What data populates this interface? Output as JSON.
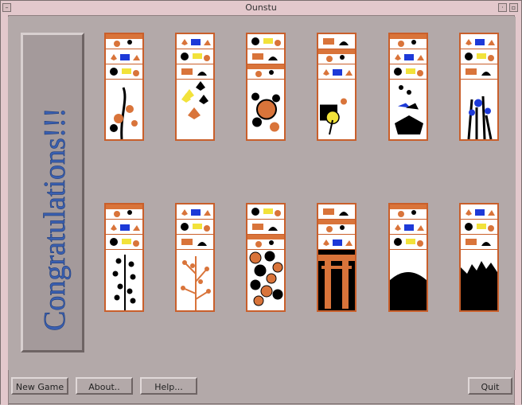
{
  "window": {
    "title": "Ounstu"
  },
  "congrats": {
    "text": "Congratulations!!!"
  },
  "buttons": {
    "new_game": "New Game",
    "about": "About..",
    "help": "Help...",
    "quit": "Quit"
  },
  "colors": {
    "card_border": "#c95f2b",
    "card_orange": "#d9743a",
    "card_black": "#000000",
    "card_blue": "#1d3ad8",
    "card_yellow": "#f2e23a",
    "congrats_text": "#3a5fb0",
    "background": "#b3a9a9"
  },
  "piles": {
    "top": [
      {
        "suit": "plum",
        "icon": "plum-flower-icon"
      },
      {
        "suit": "maple",
        "icon": "maple-leaf-icon"
      },
      {
        "suit": "peony",
        "icon": "peony-flower-icon"
      },
      {
        "suit": "chrysanthemum",
        "icon": "chrysanthemum-icon"
      },
      {
        "suit": "paulownia",
        "icon": "paulownia-icon"
      },
      {
        "suit": "iris",
        "icon": "iris-flower-icon"
      }
    ],
    "bottom": [
      {
        "suit": "bush-clover",
        "icon": "bush-clover-icon"
      },
      {
        "suit": "willow",
        "icon": "willow-icon"
      },
      {
        "suit": "cherry",
        "icon": "cherry-blossom-icon"
      },
      {
        "suit": "willow-gate",
        "icon": "torii-gate-icon"
      },
      {
        "suit": "pampas-moon",
        "icon": "moon-icon"
      },
      {
        "suit": "pine",
        "icon": "pine-icon"
      }
    ]
  }
}
